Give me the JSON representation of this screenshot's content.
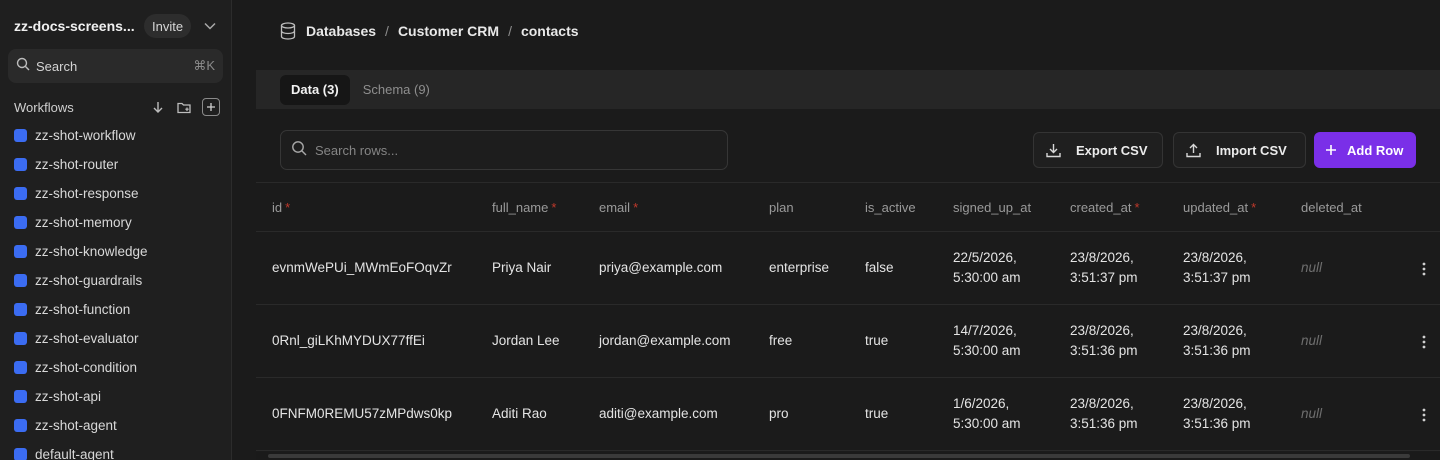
{
  "workspace": {
    "name": "zz-docs-screens...",
    "invite_label": "Invite"
  },
  "sidebar_search": {
    "label": "Search",
    "shortcut": "⌘K"
  },
  "workflows": {
    "title": "Workflows",
    "items": [
      {
        "label": "zz-shot-workflow"
      },
      {
        "label": "zz-shot-router"
      },
      {
        "label": "zz-shot-response"
      },
      {
        "label": "zz-shot-memory"
      },
      {
        "label": "zz-shot-knowledge"
      },
      {
        "label": "zz-shot-guardrails"
      },
      {
        "label": "zz-shot-function"
      },
      {
        "label": "zz-shot-evaluator"
      },
      {
        "label": "zz-shot-condition"
      },
      {
        "label": "zz-shot-api"
      },
      {
        "label": "zz-shot-agent"
      },
      {
        "label": "default-agent"
      }
    ],
    "item_color": "#3b6cf2"
  },
  "breadcrumb": {
    "root": "Databases",
    "database": "Customer CRM",
    "table": "contacts"
  },
  "tabs": {
    "data": "Data (3)",
    "schema": "Schema (9)"
  },
  "row_search": {
    "placeholder": "Search rows..."
  },
  "actions": {
    "export": "Export CSV",
    "import": "Import CSV",
    "add": "Add Row",
    "add_color": "#7a2fe8"
  },
  "columns": {
    "id": "id",
    "full_name": "full_name",
    "email": "email",
    "plan": "plan",
    "is_active": "is_active",
    "signed_up_at": "signed_up_at",
    "created_at": "created_at",
    "updated_at": "updated_at",
    "deleted_at": "deleted_at",
    "required_mark": "*"
  },
  "rows": [
    {
      "id": "evnmWePUi_MWmEoFOqvZr",
      "full_name": "Priya Nair",
      "email": "priya@example.com",
      "plan": "enterprise",
      "is_active": "false",
      "signed_up_at": [
        "22/5/2026,",
        "5:30:00 am"
      ],
      "created_at": [
        "23/8/2026,",
        "3:51:37 pm"
      ],
      "updated_at": [
        "23/8/2026,",
        "3:51:37 pm"
      ],
      "deleted_at": "null"
    },
    {
      "id": "0Rnl_giLKhMYDUX77ffEi",
      "full_name": "Jordan Lee",
      "email": "jordan@example.com",
      "plan": "free",
      "is_active": "true",
      "signed_up_at": [
        "14/7/2026,",
        "5:30:00 am"
      ],
      "created_at": [
        "23/8/2026,",
        "3:51:36 pm"
      ],
      "updated_at": [
        "23/8/2026,",
        "3:51:36 pm"
      ],
      "deleted_at": "null"
    },
    {
      "id": "0FNFM0REMU57zMPdws0kp",
      "full_name": "Aditi Rao",
      "email": "aditi@example.com",
      "plan": "pro",
      "is_active": "true",
      "signed_up_at": [
        "1/6/2026,",
        "5:30:00 am"
      ],
      "created_at": [
        "23/8/2026,",
        "3:51:36 pm"
      ],
      "updated_at": [
        "23/8/2026,",
        "3:51:36 pm"
      ],
      "deleted_at": "null"
    }
  ]
}
